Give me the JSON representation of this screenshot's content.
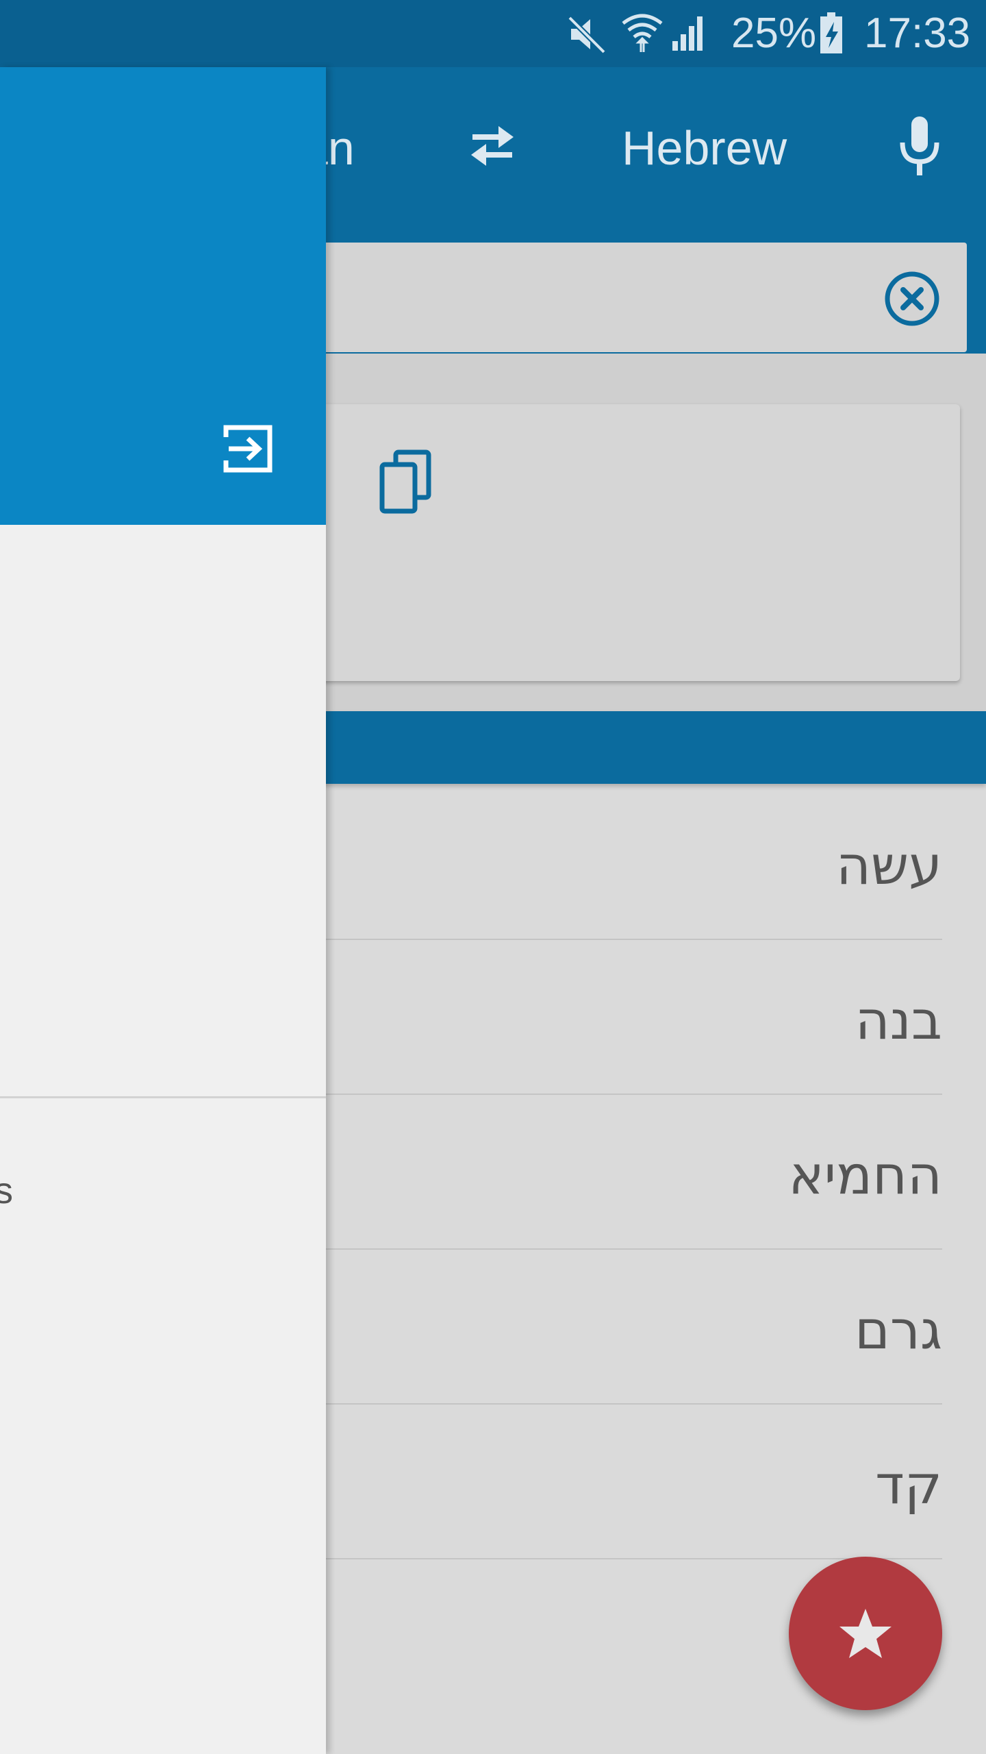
{
  "status_bar": {
    "battery_percent": "25%",
    "time": "17:33",
    "icons": [
      "mute-icon",
      "wifi-icon",
      "signal-icon",
      "battery-charging-icon"
    ]
  },
  "toolbar": {
    "source_language_partial": "an",
    "target_language": "Hebrew",
    "swap_icon": "swap-icon",
    "mic_icon": "microphone-icon"
  },
  "search": {
    "clear_icon": "clear-circle-icon"
  },
  "result": {
    "copy_icon": "copy-icon"
  },
  "suggestions": [
    {
      "text": "עשה"
    },
    {
      "text": "בנה"
    },
    {
      "text": "החמיא"
    },
    {
      "text": "גרם"
    },
    {
      "text": "קד"
    }
  ],
  "fab": {
    "icon": "star-icon"
  },
  "drawer": {
    "login_icon": "login-icon",
    "partial_item_text": "s"
  },
  "colors": {
    "status_bar": "#0a6090",
    "toolbar": "#0b6b9e",
    "drawer_header": "#0b86c4",
    "fab": "#b13a40"
  }
}
